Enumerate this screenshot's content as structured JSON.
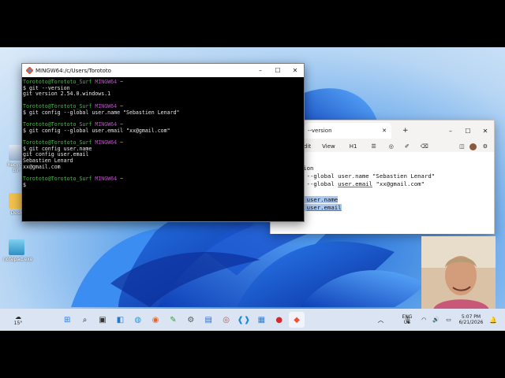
{
  "terminal": {
    "title": "MINGW64:/c/Users/Torototo",
    "lines": [
      {
        "user": "Torototo@Torototo_Surf",
        "env": "MINGW64",
        "path": "~"
      },
      {
        "text": "$ git --version"
      },
      {
        "text": "git version 2.54.0.windows.1"
      },
      {
        "text": ""
      },
      {
        "user": "Torototo@Torototo_Surf",
        "env": "MINGW64",
        "path": "~"
      },
      {
        "text": "$ git config --global user.name \"Sebastien Lenard\""
      },
      {
        "text": ""
      },
      {
        "user": "Torototo@Torototo_Surf",
        "env": "MINGW64",
        "path": "~"
      },
      {
        "text": "$ git config --global user.email \"xx@gmail.com\""
      },
      {
        "text": ""
      },
      {
        "user": "Torototo@Torototo_Surf",
        "env": "MINGW64",
        "path": "~"
      },
      {
        "text": "$ git config user.name"
      },
      {
        "text": "git config user.email"
      },
      {
        "text": "Sebastien Lenard"
      },
      {
        "text": "xx@gmail.com"
      },
      {
        "text": ""
      },
      {
        "user": "Torototo@Torototo_Surf",
        "env": "MINGW64",
        "path": "~"
      },
      {
        "text": "$"
      }
    ]
  },
  "notepad": {
    "tab_label": "--version",
    "new_tab": "+",
    "menu": [
      "dit",
      "View",
      "H1",
      "☰",
      "◎",
      "✐",
      "⌫"
    ],
    "lines": [
      {
        "text": "ersion"
      },
      {
        "text": "fig --global user.name \"Sebastien Lenard\""
      },
      {
        "pre": "fig --global ",
        "ul": "user.email",
        "post": " \"xx@gmail.com\""
      },
      {
        "text": ""
      },
      {
        "text": "fig user.name",
        "selected": true
      },
      {
        "pre": "fig ",
        "ul": "user.email",
        "post": "",
        "selected": true
      }
    ]
  },
  "desktop": {
    "icons": [
      {
        "label": "Recycle Bin",
        "icon": "recycle-bin-icon"
      },
      {
        "label": "Desk",
        "icon": "folder-icon"
      },
      {
        "label": "notepad.exe",
        "icon": "notepad-shortcut-icon"
      }
    ]
  },
  "taskbar": {
    "weather": "15°",
    "lang_top": "ENG",
    "lang_bottom": "US",
    "time": "5:07 PM",
    "date": "6/21/2026",
    "apps": [
      "start-icon",
      "search-icon",
      "task-view-icon",
      "widgets-icon",
      "edge-icon",
      "firefox-icon",
      "notepad-icon",
      "settings-icon",
      "app-icon",
      "chrome-icon",
      "vscode-icon",
      "notes-icon",
      "record-icon",
      "git-bash-icon"
    ]
  },
  "colors": {
    "prompt_user": "#3fc23f",
    "prompt_env": "#c04dcf",
    "prompt_path": "#c9b934",
    "selection": "#a9c8f0"
  }
}
